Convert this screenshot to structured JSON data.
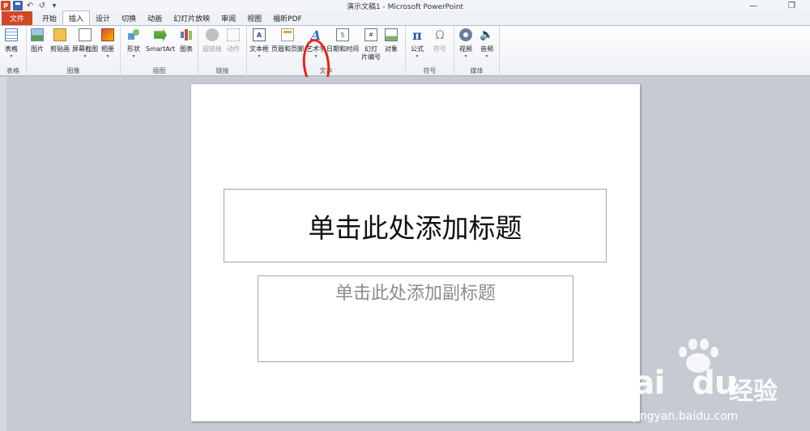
{
  "window": {
    "title": "演示文稿1 - Microsoft PowerPoint",
    "app_icon": "P",
    "minimize_glyph": "—",
    "restore_glyph": "❐"
  },
  "qat": {
    "undo_glyph": "↶",
    "redo_glyph": "↺",
    "more_glyph": "▾"
  },
  "tabs": [
    {
      "label": "文件"
    },
    {
      "label": "开始"
    },
    {
      "label": "插入"
    },
    {
      "label": "设计"
    },
    {
      "label": "切换"
    },
    {
      "label": "动画"
    },
    {
      "label": "幻灯片放映"
    },
    {
      "label": "审阅"
    },
    {
      "label": "视图"
    },
    {
      "label": "福昕PDF"
    }
  ],
  "active_tab": "插入",
  "ribbon": {
    "groups": {
      "table": "表格",
      "images": "图像",
      "illustrations": "插图",
      "links": "链接",
      "text": "文本",
      "symbols": "符号",
      "media": "媒体"
    },
    "buttons": {
      "table": "表格",
      "picture": "图片",
      "clipart": "剪贴画",
      "screenshot": "屏幕截图",
      "album": "相册",
      "shapes": "形状",
      "smartart": "SmartArt",
      "chart": "图表",
      "hyperlink": "超链接",
      "action": "动作",
      "textbox": "文本框",
      "header_footer": "页眉和页脚",
      "wordart": "艺术字",
      "datetime": "日期和时间",
      "slide_number": "幻灯\n片编号",
      "object": "对象",
      "equation": "公式",
      "symbol": "符号",
      "video": "视频",
      "audio": "音频"
    },
    "icon_glyphs": {
      "wordart": "A",
      "textbox": "A",
      "equation": "π",
      "symbol": "Ω",
      "audio": "🔈",
      "slide_number": "#",
      "datetime": "5"
    },
    "dropdown_glyph": "▾",
    "highlight_color": "#e8211c"
  },
  "slide": {
    "title_placeholder": "单击此处添加标题",
    "subtitle_placeholder": "单击此处添加副标题"
  },
  "watermark": {
    "brand": "Bai",
    "brand_du": "du",
    "cn": "经验",
    "url": "jingyan.baidu.com"
  }
}
